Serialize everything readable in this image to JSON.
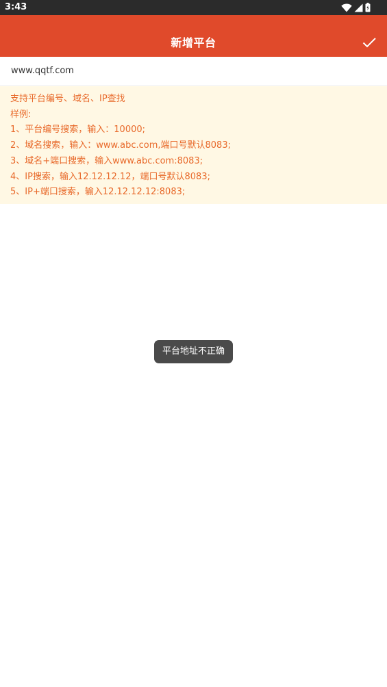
{
  "status_bar": {
    "time": "3:43",
    "icons": [
      "wifi-icon",
      "cellular-signal-icon",
      "battery-icon"
    ]
  },
  "app_bar": {
    "title": "新增平台",
    "confirm_icon": "check-icon"
  },
  "address_input": {
    "value": "www.qqtf.com"
  },
  "hint": {
    "lines": [
      "支持平台编号、域名、IP查找",
      "样例:",
      "1、平台编号搜索，输入：10000;",
      "2、域名搜索，输入：www.abc.com,端口号默认8083;",
      "3、域名+端口搜索，输入www.abc.com:8083;",
      "4、IP搜索，输入12.12.12.12，端口号默认8083;",
      "5、IP+端口搜索，输入12.12.12.12:8083;"
    ]
  },
  "toast": {
    "message": "平台地址不正确"
  },
  "colors": {
    "status_bar_bg": "#2b2b2b",
    "app_bar_bg": "#e04a2b",
    "hint_bg": "#fff8e4",
    "hint_text": "#e8692a",
    "toast_bg": "#4a4a4a"
  }
}
